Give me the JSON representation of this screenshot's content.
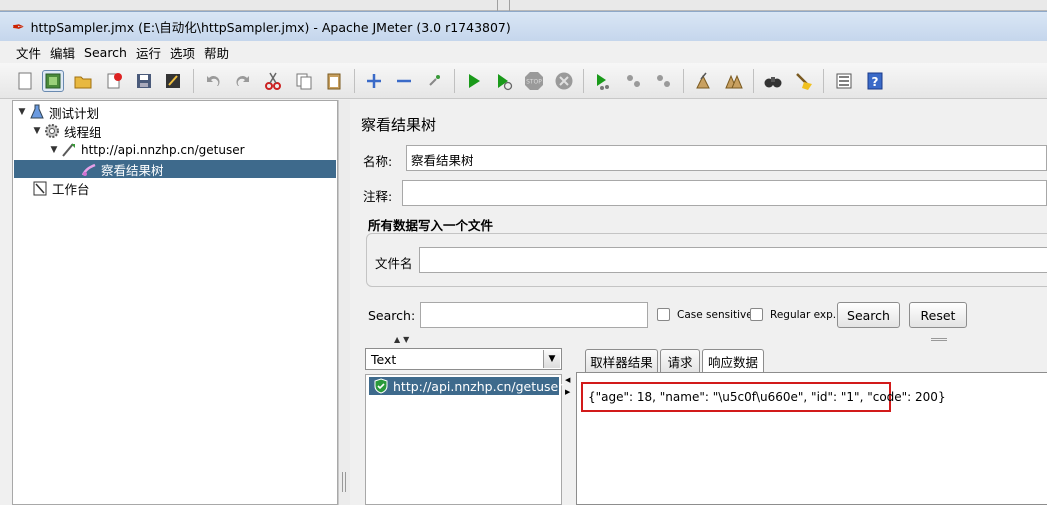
{
  "window": {
    "title": "httpSampler.jmx (E:\\自动化\\httpSampler.jmx) - Apache JMeter (3.0 r1743807)"
  },
  "menu": [
    "文件",
    "编辑",
    "Search",
    "运行",
    "选项",
    "帮助"
  ],
  "toolbar": {
    "icons": [
      "new-icon",
      "templates-icon",
      "open-icon",
      "close-icon",
      "save-icon",
      "save-screenshot-icon",
      "undo-icon",
      "redo-icon",
      "cut-icon",
      "copy-icon",
      "paste-icon",
      "expand-icon",
      "collapse-icon",
      "toggle-icon",
      "start-icon",
      "start-no-pause-icon",
      "stop-icon",
      "shutdown-icon",
      "remote-start-icon",
      "remote-stop-icon",
      "remote-shutdown-icon",
      "clear-icon",
      "clear-all-icon",
      "search-icon",
      "reset-search-icon",
      "function-helper-icon",
      "help-icon"
    ]
  },
  "tree": {
    "items": [
      {
        "label": "测试计划",
        "icon": "test-plan-icon"
      },
      {
        "label": "线程组",
        "icon": "thread-group-icon"
      },
      {
        "label": "http://api.nnzhp.cn/getuser",
        "icon": "http-sampler-icon"
      },
      {
        "label": "察看结果树",
        "icon": "listener-icon",
        "selected": true
      },
      {
        "label": "工作台",
        "icon": "workbench-icon"
      }
    ]
  },
  "panel": {
    "title": "察看结果树",
    "name_label": "名称:",
    "name_value": "察看结果树",
    "comment_label": "注释:",
    "comment_value": "",
    "file_group_title": "所有数据写入一个文件",
    "filename_label": "文件名",
    "filename_value": ""
  },
  "search": {
    "label": "Search:",
    "value": "",
    "case_sensitive_label": "Case sensitive",
    "regex_label": "Regular exp.",
    "search_button": "Search",
    "reset_button": "Reset"
  },
  "renderer": {
    "selected": "Text"
  },
  "results": {
    "items": [
      {
        "label": "http://api.nnzhp.cn/getuser",
        "status": "success"
      }
    ]
  },
  "tabs": [
    {
      "label": "取样器结果",
      "active": false
    },
    {
      "label": "请求",
      "active": false
    },
    {
      "label": "响应数据",
      "active": true
    }
  ],
  "response": {
    "text": "{\"age\": 18, \"name\": \"\\u5c0f\\u660e\", \"id\": \"1\", \"code\": 200}"
  },
  "colors": {
    "selection": "#3e6a8c",
    "highlight_box": "#d21a1a",
    "run_green": "#1a9a1a"
  }
}
